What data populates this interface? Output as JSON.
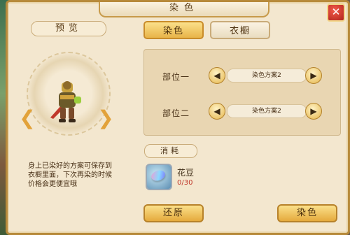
{
  "window": {
    "title": "染色"
  },
  "preview": {
    "label": "预览",
    "description": "身上已染好的方案可保存到衣橱里面，下次再染的时候价格会更便宜哦"
  },
  "tabs": [
    {
      "label": "染色",
      "active": true
    },
    {
      "label": "衣橱",
      "active": false
    }
  ],
  "dye_parts": [
    {
      "label": "部位一",
      "scheme": "染色方案2",
      "prev_icon": "triangle-left",
      "next_icon": "triangle-right"
    },
    {
      "label": "部位二",
      "scheme": "染色方案2",
      "prev_icon": "triangle-left",
      "next_icon": "triangle-right"
    }
  ],
  "consume": {
    "label": "消耗",
    "item": {
      "name": "花豆",
      "count": "0/30",
      "icon": "bean-gem-icon"
    }
  },
  "buttons": {
    "reset": "还原",
    "dye": "染色"
  },
  "colors": {
    "accent": "#e8b449",
    "panel_bg": "#f3e7cf",
    "count_red": "#c0392b",
    "border_gold": "#b78a3b"
  }
}
